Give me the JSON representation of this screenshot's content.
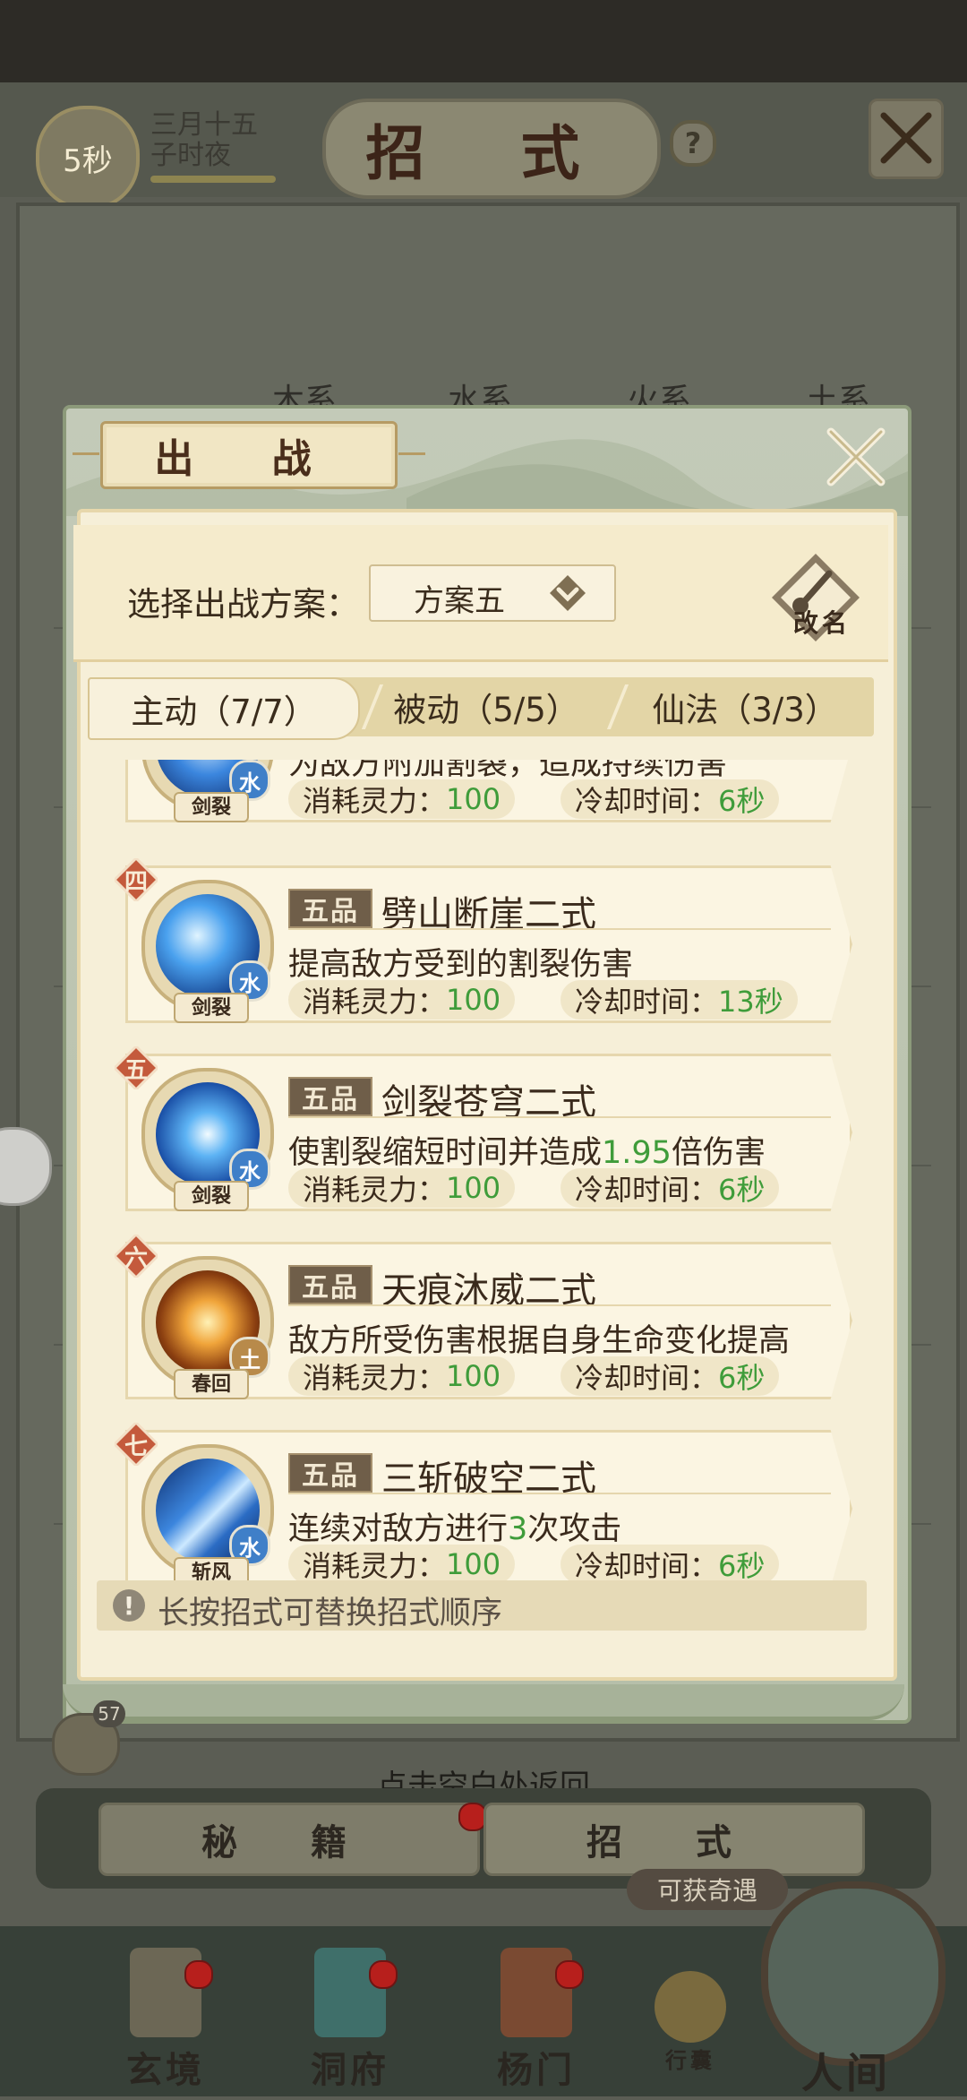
{
  "background": {
    "timer": "5秒",
    "date_line1": "三月十五",
    "date_line2": "子时夜",
    "title": "招 式",
    "help": "?",
    "tabs": [
      "木系",
      "水系",
      "火系",
      "土系"
    ]
  },
  "dialog": {
    "title": "出 战",
    "plan_label": "选择出战方案：",
    "plan_value": "方案五",
    "rename_label": "改名",
    "tabs": [
      {
        "label": "主动（7/7）",
        "active": true
      },
      {
        "label": "被动（5/5）",
        "active": false
      },
      {
        "label": "仙法（3/3）",
        "active": false
      }
    ],
    "skills": [
      {
        "order": "",
        "icon_label": "剑裂",
        "element": "水",
        "grade": "",
        "name": "",
        "desc_pre": "为敌方附加割裂，造成持续伤害",
        "desc_num": "",
        "desc_post": "",
        "cost_label": "消耗灵力：",
        "cost_value": "100",
        "cd_label": "冷却时间：",
        "cd_value": "6秒"
      },
      {
        "order": "四",
        "icon_label": "剑裂",
        "element": "水",
        "grade": "五品",
        "name": "劈山断崖二式",
        "desc_pre": "提高敌方受到的割裂伤害",
        "desc_num": "",
        "desc_post": "",
        "cost_label": "消耗灵力：",
        "cost_value": "100",
        "cd_label": "冷却时间：",
        "cd_value": "13秒"
      },
      {
        "order": "五",
        "icon_label": "剑裂",
        "element": "水",
        "grade": "五品",
        "name": "剑裂苍穹二式",
        "desc_pre": "使割裂缩短时间并造成",
        "desc_num": "1.95",
        "desc_post": "倍伤害",
        "cost_label": "消耗灵力：",
        "cost_value": "100",
        "cd_label": "冷却时间：",
        "cd_value": "6秒"
      },
      {
        "order": "六",
        "icon_label": "春回",
        "element": "土",
        "grade": "五品",
        "name": "天痕沐威二式",
        "desc_pre": "敌方所受伤害根据自身生命变化提高",
        "desc_num": "",
        "desc_post": "",
        "cost_label": "消耗灵力：",
        "cost_value": "100",
        "cd_label": "冷却时间：",
        "cd_value": "6秒"
      },
      {
        "order": "七",
        "icon_label": "斩风",
        "element": "水",
        "grade": "五品",
        "name": "三斩破空二式",
        "desc_pre": "连续对敌方进行",
        "desc_num": "3",
        "desc_post": "次攻击",
        "cost_label": "消耗灵力：",
        "cost_value": "100",
        "cd_label": "冷却时间：",
        "cd_value": "6秒"
      }
    ],
    "hint": "长按招式可替换招式顺序",
    "hint_icon": "!"
  },
  "bottom": {
    "chat_count": "57",
    "back_hint": "点击空白处返回",
    "tab_left": "秘 籍",
    "tab_right": "招 式",
    "qiyu": "可获奇遇",
    "nav": [
      "玄境",
      "洞府",
      "杨门",
      "行囊",
      "人间"
    ]
  },
  "colors": {
    "accent_green": "#3f9c3a",
    "order_badge": "#c45a3c",
    "water": "#3f7fc8",
    "earth": "#b88a4a"
  }
}
